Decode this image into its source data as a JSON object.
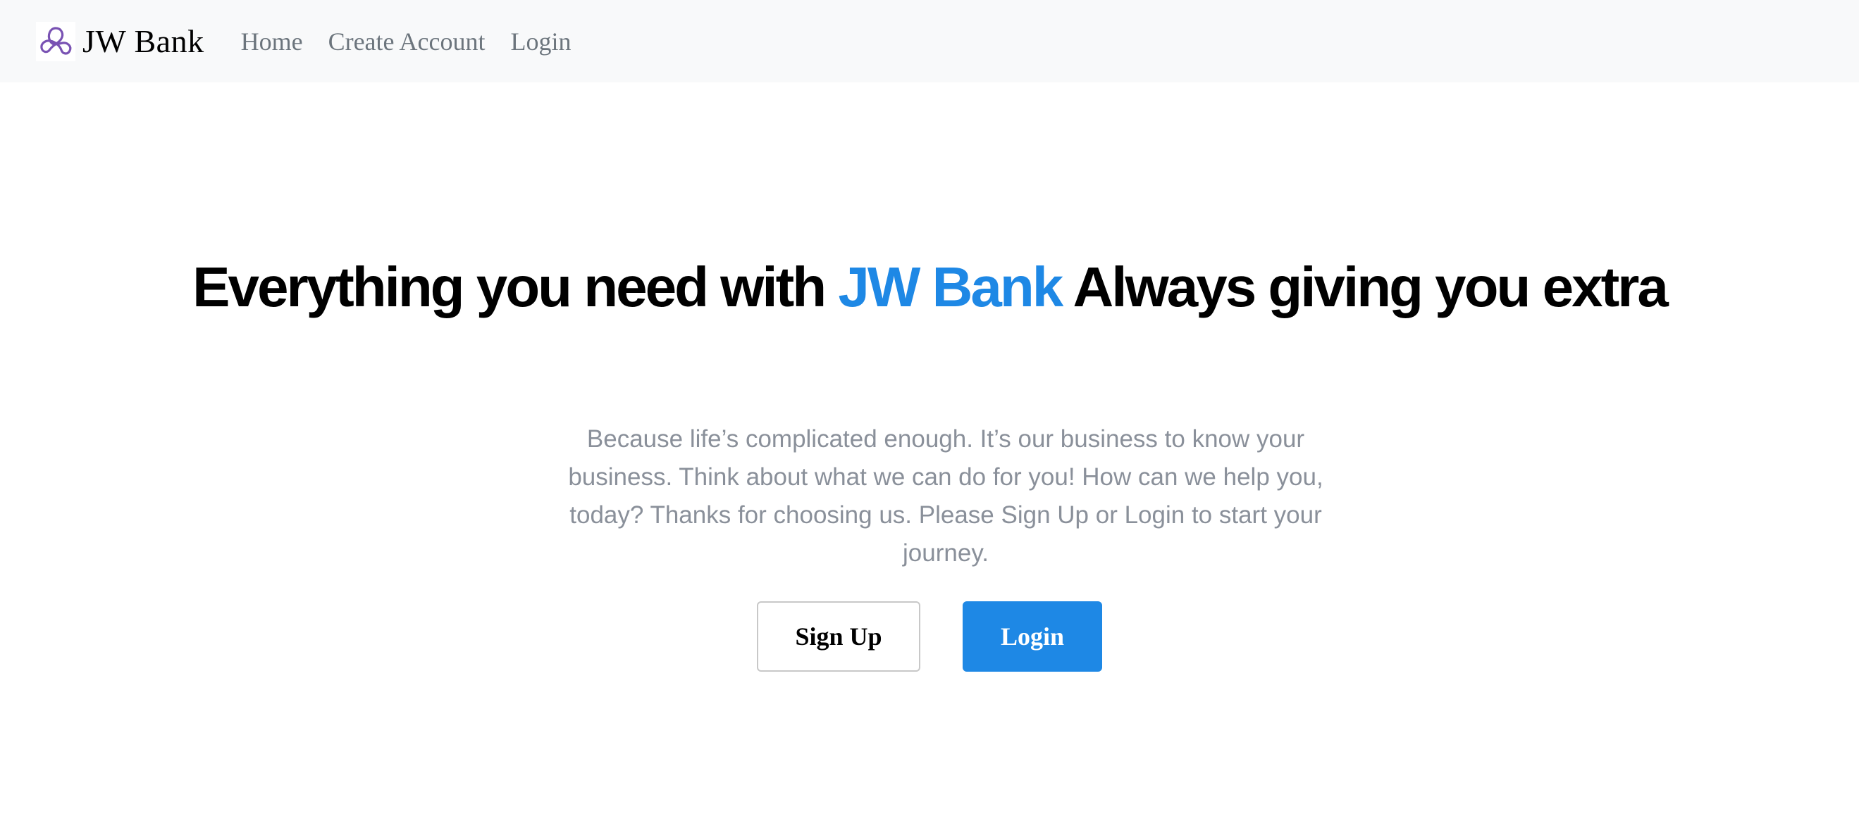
{
  "navbar": {
    "brand": {
      "name": "JW Bank",
      "logo_icon": "trinity-knot-icon",
      "logo_color": "#7952b3"
    },
    "links": [
      {
        "label": "Home"
      },
      {
        "label": "Create Account"
      },
      {
        "label": "Login"
      }
    ]
  },
  "hero": {
    "title_before": "Everything you need with ",
    "title_accent": "JW Bank",
    "title_after": " Always giving you extra",
    "lead": "Because life’s complicated enough. It’s our business to know your business. Think about what we can do for you! How can we help you, today? Thanks for choosing us. Please Sign Up or Login to start your journey.",
    "buttons": {
      "signup_label": "Sign Up",
      "login_label": "Login"
    }
  },
  "colors": {
    "accent": "#1e88e5",
    "navbar_bg": "#f8f9fa",
    "muted_text": "#8a909a"
  }
}
